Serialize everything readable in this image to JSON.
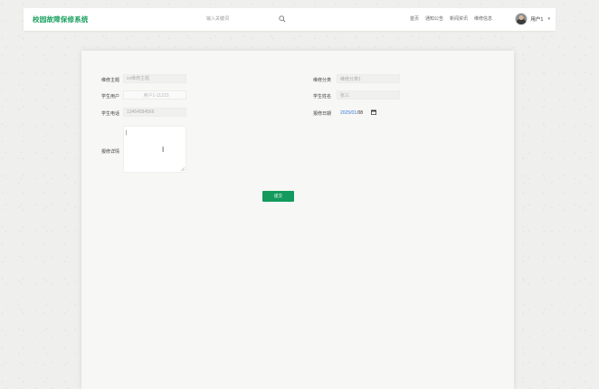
{
  "header": {
    "brand": "校园故障保修系统",
    "search_placeholder": "输入关键词",
    "nav": [
      "首页",
      "通知公告",
      "新闻资讯",
      "维修信息"
    ],
    "user_name": "用户1",
    "user_caret": "▾"
  },
  "form": {
    "title_label": "维修主题",
    "title_placeholder": "xx维修主题",
    "student_user_label": "学生用户",
    "student_user_value": "用户1-11223",
    "student_phone_label": "学生电话",
    "student_phone_value": "13454584566",
    "detail_label": "报修详情",
    "category_label": "维修分类",
    "category_value": "维修分类1",
    "student_name_label": "学生姓名",
    "student_name_value": "张三",
    "date_label": "报修日期",
    "date_prefix": "2025/01/",
    "date_day": "08",
    "submit_label": "提交"
  },
  "icons": {
    "search": "search-icon",
    "calendar": "calendar-icon",
    "avatar": "avatar"
  },
  "colors": {
    "brand": "#17a05d",
    "submit": "#139a5c",
    "date": "#3c7ad9"
  }
}
